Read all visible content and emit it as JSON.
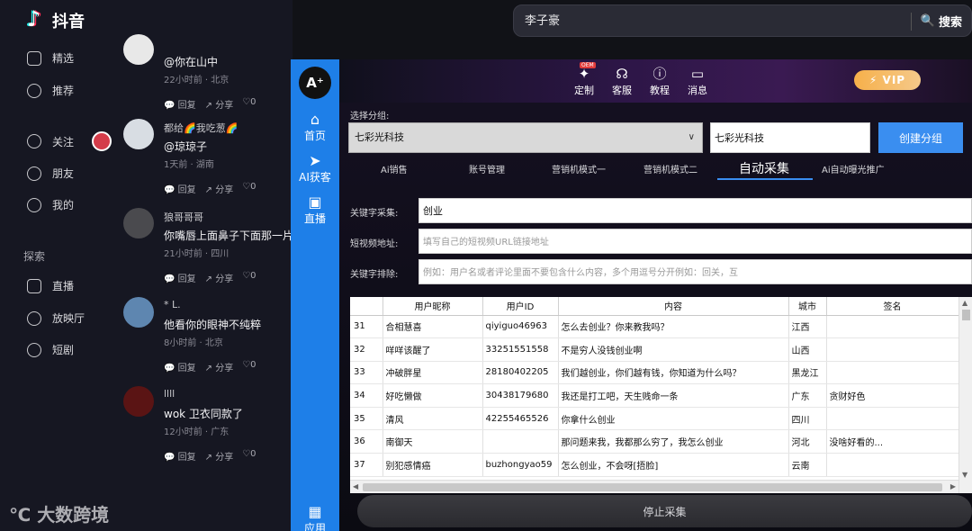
{
  "douyin": {
    "logo": "抖音",
    "nav": [
      {
        "label": "精选",
        "icon": "home-icon"
      },
      {
        "label": "推荐",
        "icon": "sparkle-icon"
      },
      {
        "label": "关注",
        "icon": "follow-icon"
      },
      {
        "label": "朋友",
        "icon": "friends-icon"
      },
      {
        "label": "我的",
        "icon": "user-icon"
      }
    ],
    "explore": "探索",
    "explore_items": [
      {
        "label": "直播",
        "icon": "tv-icon"
      },
      {
        "label": "放映厅",
        "icon": "film-icon"
      },
      {
        "label": "短剧",
        "icon": "play-icon"
      }
    ],
    "search": {
      "value": "李子豪",
      "button": "搜索"
    }
  },
  "comments": [
    {
      "name": "",
      "text": "@你在山中",
      "time": "22小时前 · 北京"
    },
    {
      "name": "都给🌈我吃葱🌈",
      "text": "@琼琼子",
      "time": "1天前 · 湖南"
    },
    {
      "name": "狼哥哥哥",
      "text": "你嘴唇上面鼻子下面那一片",
      "time": "21小时前 · 四川"
    },
    {
      "name": "* L.",
      "text": "他看你的眼神不纯粹",
      "time": "8小时前 · 北京"
    },
    {
      "name": "llll",
      "text": "wok 卫衣同款了",
      "time": "12小时前 · 广东"
    }
  ],
  "comment_actions": {
    "reply": "回复",
    "share": "分享",
    "likes": "0"
  },
  "tool": {
    "logo": "A⁺",
    "sidebar": [
      {
        "label": "首页",
        "icon": "home-icon"
      },
      {
        "label": "AI获客",
        "icon": "send-icon"
      },
      {
        "label": "直播",
        "icon": "live-icon"
      },
      {
        "label": "应用",
        "icon": "apps-icon"
      }
    ],
    "header": [
      {
        "label": "定制",
        "icon": "wand-icon"
      },
      {
        "label": "客服",
        "icon": "headset-icon"
      },
      {
        "label": "教程",
        "icon": "help-icon"
      },
      {
        "label": "消息",
        "icon": "message-icon"
      }
    ],
    "oem": "OEM",
    "vip": "VIP",
    "group_label": "选择分组:",
    "group_selected": "七彩光科技",
    "group_name_value": "七彩光科技",
    "create_group": "创建分组",
    "tabs": [
      "Ai销售",
      "账号管理",
      "营销机模式一",
      "营销机模式二",
      "自动采集",
      "Ai自动曝光推广"
    ],
    "active_tab": "自动采集",
    "keyword_label": "关键字采集:",
    "keyword_value": "创业",
    "video_label": "短视频地址:",
    "video_placeholder": "填写自己的短视频URL链接地址",
    "exclude_label": "关键字排除:",
    "exclude_placeholder": "例如：用户名或者评论里面不要包含什么内容，多个用逗号分开例如：回关，互",
    "columns": [
      "",
      "用户昵称",
      "用户ID",
      "内容",
      "城市",
      "签名"
    ],
    "rows": [
      [
        "31",
        "合相慧喜",
        "qiyiguo46963",
        "怎么去创业？你来教我吗？",
        "江西",
        ""
      ],
      [
        "32",
        "咩咩该醒了",
        "33251551558",
        "不是穷人没钱创业啊",
        "山西",
        ""
      ],
      [
        "33",
        "冲破胖星",
        "28180402205",
        "我们越创业，你们越有钱，你知道为什么吗？",
        "黑龙江",
        ""
      ],
      [
        "34",
        "好吃懒做",
        "30438179680",
        "我还是打工吧，天生贱命一条",
        "广东",
        "贪财好色"
      ],
      [
        "35",
        "清风",
        "42255465526",
        "你拿什么创业",
        "四川",
        ""
      ],
      [
        "36",
        "南御天",
        "",
        "那问题来我，我都那么穷了，我怎么创业",
        "河北",
        "没啥好看的..."
      ],
      [
        "37",
        "别犯感情癌",
        "buzhongyao59",
        "怎么创业，不会呀[捂脸]",
        "云南",
        ""
      ]
    ],
    "stop_button": "停止采集"
  },
  "watermark": "大数跨境"
}
